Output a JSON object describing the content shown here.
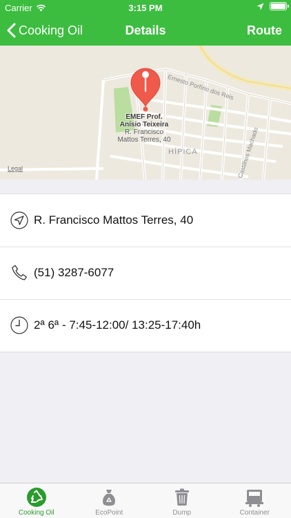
{
  "status_bar": {
    "carrier": "Carrier",
    "time": "3:15 PM"
  },
  "nav": {
    "back_label": "Cooking Oil",
    "title": "Details",
    "route_label": "Route"
  },
  "map": {
    "street_name": "Ernesto Porfírio dos Reis",
    "street_name_2": "Castilhos Machado",
    "district": "HÍPICA",
    "poi_name_line1": "EMEF Prof.",
    "poi_name_line2": "Anísio Teixeira",
    "poi_address_line1": "R. Francisco",
    "poi_address_line2": "Mattos Terres, 40",
    "legal": "Legal",
    "pin_color": "#f05a4b"
  },
  "details": {
    "address": "R. Francisco Mattos Terres, 40",
    "phone": "(51) 3287-6077",
    "hours": "2ª 6ª - 7:45-12:00/ 13:25-17:40h"
  },
  "tabs": [
    {
      "label": "Cooking Oil",
      "icon": "recycle-icon",
      "active": true
    },
    {
      "label": "EcoPoint",
      "icon": "bag-icon",
      "active": false
    },
    {
      "label": "Dump",
      "icon": "trash-icon",
      "active": false
    },
    {
      "label": "Container",
      "icon": "container-icon",
      "active": false
    }
  ],
  "colors": {
    "brand_green": "#3cbd3f",
    "active_tab": "#2a9c2d"
  }
}
